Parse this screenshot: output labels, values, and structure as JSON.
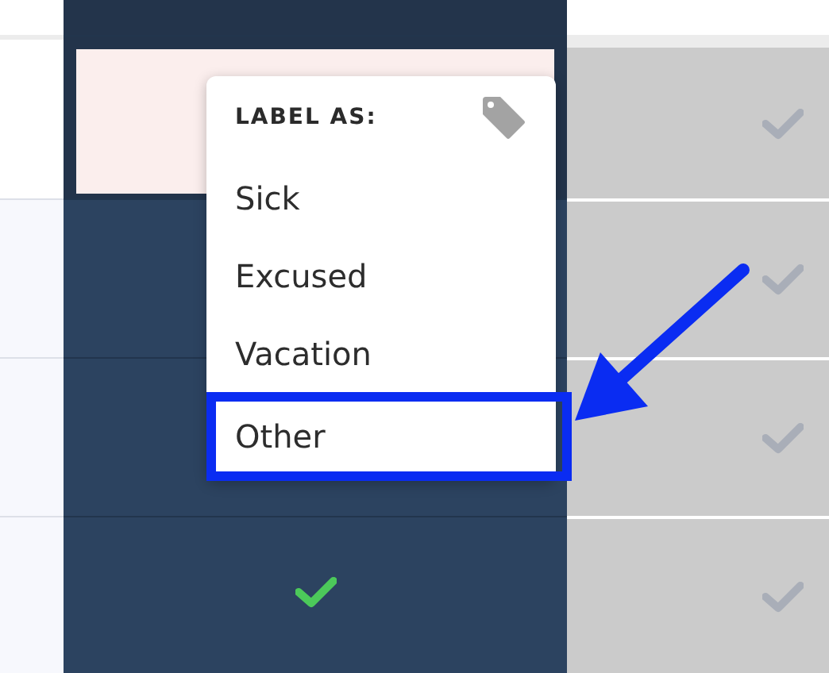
{
  "rows": [
    {
      "kind": "flagged"
    },
    {
      "kind": "blank"
    },
    {
      "kind": "blank"
    },
    {
      "kind": "present"
    }
  ],
  "menu": {
    "title": "LABEL AS:",
    "items": [
      {
        "label": "Sick",
        "selected": false
      },
      {
        "label": "Excused",
        "selected": false
      },
      {
        "label": "Vacation",
        "selected": false
      },
      {
        "label": "Other",
        "selected": true
      }
    ]
  }
}
